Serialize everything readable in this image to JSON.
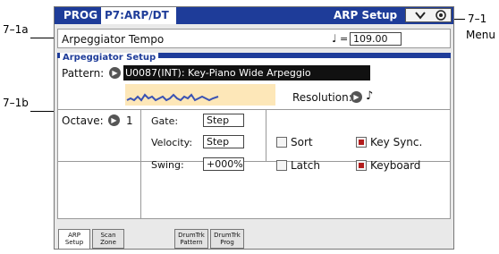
{
  "callouts": {
    "tempo_ref": "7–1a",
    "setup_ref": "7–1b",
    "menu_ref": "7–1",
    "menu_word": "Menu"
  },
  "header": {
    "mode": "PROG",
    "page": "P7:ARP/DT",
    "tab_title": "ARP Setup",
    "menu_icon": "chevron-down-icon"
  },
  "tempo": {
    "label": "Arpeggiator Tempo",
    "note_symbol": "♩",
    "equals": "=",
    "value": "109.00"
  },
  "setup": {
    "section_title": "Arpeggiator Setup",
    "pattern_label": "Pattern:",
    "pattern_value": "U0087(INT): Key-Piano Wide Arpeggio",
    "resolution_label": "Resolution:",
    "resolution_value": "♪",
    "octave_label": "Octave:",
    "octave_value": "1",
    "gate_label": "Gate:",
    "gate_value": "Step",
    "velocity_label": "Velocity:",
    "velocity_value": "Step",
    "swing_label": "Swing:",
    "swing_value": "+000%",
    "sort_label": "Sort",
    "sort_checked": false,
    "latch_label": "Latch",
    "latch_checked": false,
    "keysync_label": "Key Sync.",
    "keysync_checked": true,
    "keyboard_label": "Keyboard",
    "keyboard_checked": true
  },
  "tabs": [
    {
      "line1": "ARP",
      "line2": "Setup",
      "active": true
    },
    {
      "line1": "Scan",
      "line2": "Zone",
      "active": false
    },
    {
      "line1": "DrumTrk",
      "line2": "Pattern",
      "active": false
    },
    {
      "line1": "DrumTrk",
      "line2": "Prog",
      "active": false
    }
  ],
  "colors": {
    "titlebar": "#1e3c99",
    "accent_red": "#b21c1c",
    "pattern_bg": "#111111",
    "preview_bg": "#fde7b8"
  }
}
